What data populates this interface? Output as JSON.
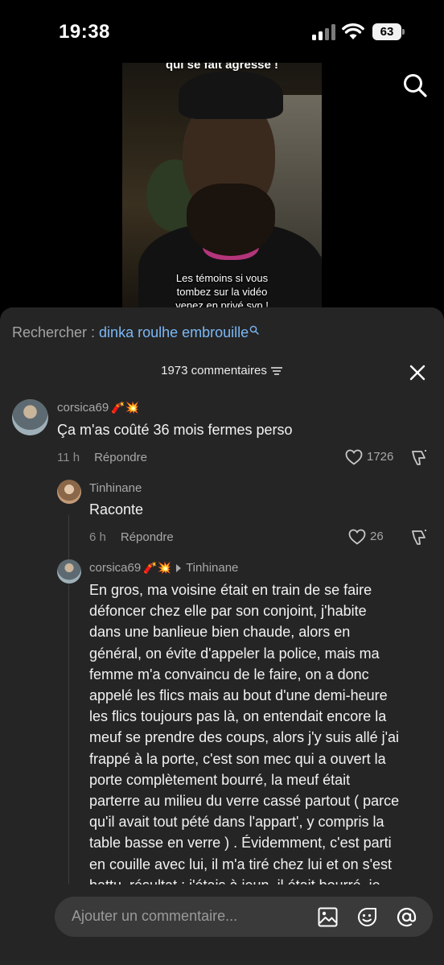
{
  "status": {
    "time": "19:38",
    "battery": "63"
  },
  "video": {
    "caption_top": "qui se fait agressé !",
    "caption_bottom": [
      "Les témoins si vous",
      "tombez sur la vidéo",
      "venez en privé svp !"
    ]
  },
  "search": {
    "label": "Rechercher : ",
    "query": "dinka roulhe embrouille"
  },
  "comments_header": {
    "count": "1973 commentaires"
  },
  "comments": [
    {
      "username": "corsica69",
      "emoji": "🧨💥",
      "text": "Ça m'as coûté 36 mois fermes perso",
      "time": "11 h",
      "reply_label": "Répondre",
      "likes": "1726"
    },
    {
      "username": "Tinhinane",
      "text": "Raconte",
      "time": "6 h",
      "reply_label": "Répondre",
      "likes": "26"
    },
    {
      "username": "corsica69",
      "emoji": "🧨💥",
      "reply_to": "Tinhinane",
      "text_lines": [
        "En gros, ma voisine était en train de se faire",
        "défoncer chez elle par son conjoint, j'habite",
        "dans une banlieue bien chaude, alors en",
        "général, on évite d'appeler la police, mais ma",
        "femme m'a convaincu de le faire, on a donc",
        "appelé les flics mais au bout d'une demi-heure",
        "les flics toujours pas là, on entendait encore la",
        "meuf se prendre des coups, alors j'y suis allé j'ai",
        "frappé à la porte, c'est son mec qui a ouvert la",
        "porte complètement bourré, la meuf était",
        "parterre au milieu du verre cassé partout ( parce",
        "qu'il avait tout pété dans l'appart', y compris la",
        "table basse en verre ) . Évidemment, c'est parti",
        "en couille avec lui, il m'a tiré chez lui et on s'est",
        "battu, résultat : j'étais à jeun, il était bourré, je"
      ]
    }
  ],
  "input": {
    "placeholder": "Ajouter un commentaire..."
  },
  "icons": [
    "search-icon",
    "close-icon",
    "filter-icon",
    "heart-icon",
    "dislike-icon",
    "image-icon",
    "emoji-icon",
    "mention-icon"
  ]
}
